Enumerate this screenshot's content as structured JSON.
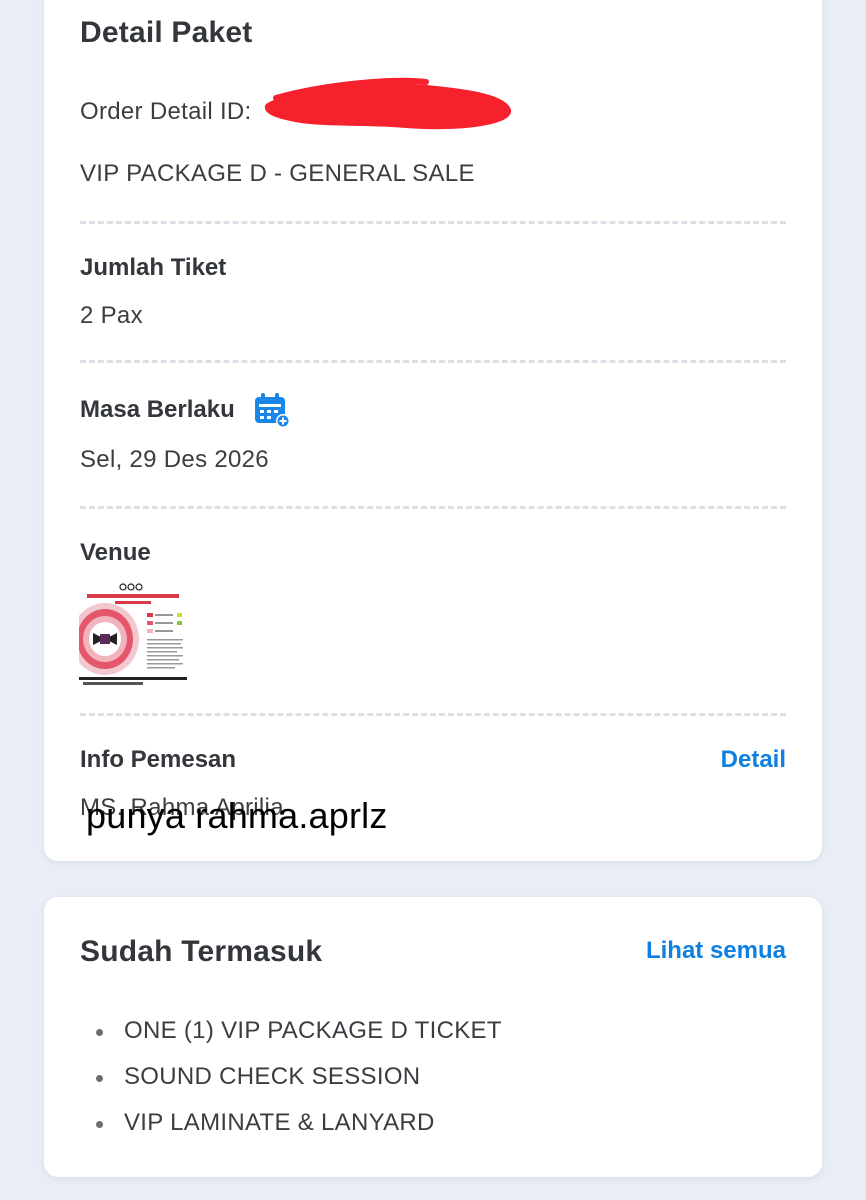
{
  "package_card": {
    "title": "Detail Paket",
    "order_label": "Order Detail ID:",
    "package_name": "VIP PACKAGE D - GENERAL SALE",
    "ticket_label": "Jumlah Tiket",
    "ticket_value": "2 Pax",
    "validity_label": "Masa Berlaku",
    "validity_icon": "calendar-add-icon",
    "validity_value": "Sel, 29 Des 2026",
    "venue_label": "Venue",
    "info_label": "Info Pemesan",
    "info_link": "Detail",
    "info_value": "MS. Rahma Aprilia",
    "watermark": "punya rahma.aprlz"
  },
  "included_card": {
    "title": "Sudah Termasuk",
    "see_all": "Lihat semua",
    "items": [
      "ONE (1) VIP PACKAGE D TICKET",
      "SOUND CHECK SESSION",
      "VIP LAMINATE & LANYARD"
    ]
  },
  "colors": {
    "accent": "#0f80e0",
    "redaction": "#f5222d",
    "background": "#e9edf5"
  }
}
